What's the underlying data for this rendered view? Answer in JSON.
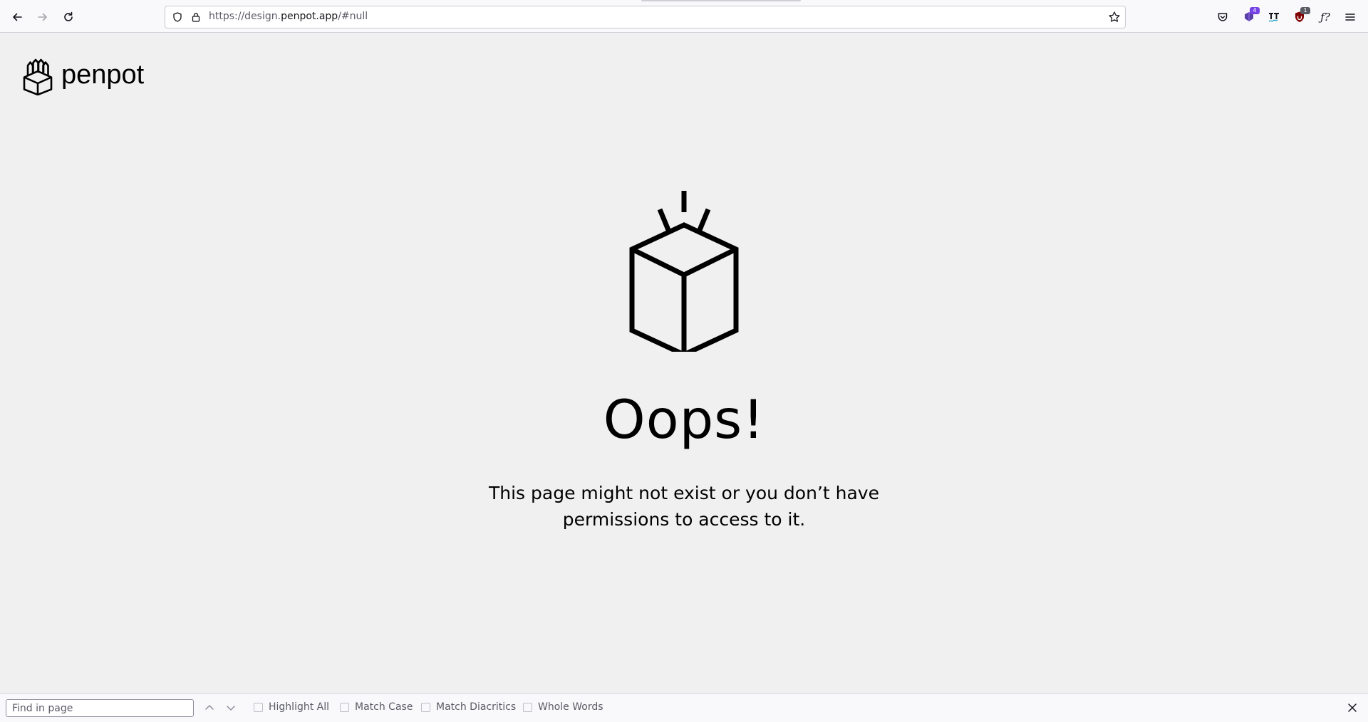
{
  "browser": {
    "url_prefix": "https://design.",
    "url_host": "penpot.app",
    "url_suffix": "/#null",
    "extension_badges": {
      "ext1": "4",
      "ext2": "1"
    },
    "fx_label": "ƒ?"
  },
  "page": {
    "logo_text": "penpot",
    "headline": "Oops!",
    "message": "This page might not exist or you don’t have permissions to access to it."
  },
  "findbar": {
    "placeholder": "Find in page",
    "options": {
      "highlight_all": "Highlight All",
      "match_case": "Match Case",
      "match_diacritics": "Match Diacritics",
      "whole_words": "Whole Words"
    }
  },
  "colors": {
    "page_background": "#f0f0f0",
    "text": "#000000",
    "toolbar": "#f9f9fb"
  }
}
